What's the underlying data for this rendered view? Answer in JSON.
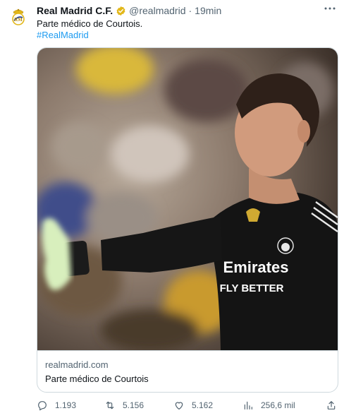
{
  "tweet": {
    "author_name": "Real Madrid C.F.",
    "handle": "@realmadrid",
    "separator": "·",
    "time": "19min",
    "text": "Parte médico de Courtois.",
    "hashtag": "#RealMadrid",
    "card": {
      "domain": "realmadrid.com",
      "title": "Parte médico de Courtois",
      "image_shirt_text_line1": "Emirates",
      "image_shirt_text_line2": "FLY BETTER"
    },
    "stats": {
      "replies": "1.193",
      "retweets": "5.156",
      "likes": "5.162",
      "views": "256,6 mil"
    }
  },
  "icons": {
    "avatar": "real-madrid-crest",
    "verified": "gold-verified-badge",
    "more": "more-icon",
    "reply": "reply-icon",
    "retweet": "retweet-icon",
    "like": "heart-icon",
    "views": "views-icon",
    "share": "share-icon"
  },
  "colors": {
    "text": "#0f1419",
    "secondary": "#536471",
    "link": "#1d9bf0",
    "border": "#cfd9de",
    "verified_gold": "#e2b719"
  }
}
